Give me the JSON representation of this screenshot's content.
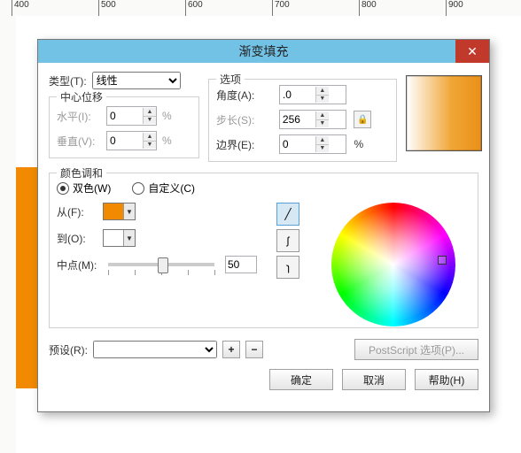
{
  "ruler": {
    "marks": [
      "400",
      "500",
      "600",
      "700",
      "800",
      "900"
    ]
  },
  "dialog": {
    "title": "渐变填充",
    "type_label": "类型(T):",
    "type_value": "线性",
    "center_offset": {
      "title": "中心位移",
      "h_label": "水平(I):",
      "h_value": "0",
      "v_label": "垂直(V):",
      "v_value": "0",
      "pct": "%"
    },
    "options": {
      "title": "选项",
      "angle_label": "角度(A):",
      "angle_value": ".0",
      "step_label": "步长(S):",
      "step_value": "256",
      "edge_label": "边界(E):",
      "edge_value": "0",
      "pct": "%"
    },
    "blend": {
      "title": "颜色调和",
      "two_color": "双色(W)",
      "custom": "自定义(C)",
      "from_label": "从(F):",
      "to_label": "到(O):",
      "mid_label": "中点(M):",
      "mid_value": "50",
      "from_color": "#f18a00",
      "to_color": "#ffffff"
    },
    "preset": {
      "label": "预设(R):",
      "add": "+",
      "remove": "−",
      "ps": "PostScript 选项(P)..."
    },
    "buttons": {
      "ok": "确定",
      "cancel": "取消",
      "help": "帮助(H)"
    }
  }
}
